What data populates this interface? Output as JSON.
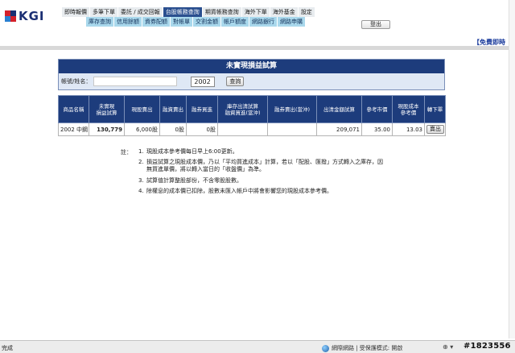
{
  "brand": {
    "name": "KGI",
    "colors": {
      "red": "#d4202a",
      "navy": "#1b2f73",
      "blue": "#2a7fd0"
    }
  },
  "menu_primary": [
    {
      "label": "即時報價",
      "active": false
    },
    {
      "label": "多筆下單",
      "active": false
    },
    {
      "label": "委託 / 成交回報",
      "active": false
    },
    {
      "label": "台股帳務查詢",
      "active": true
    },
    {
      "label": "期貨帳務查詢",
      "active": false
    },
    {
      "label": "海外下單",
      "active": false
    },
    {
      "label": "海外基金",
      "active": false
    },
    {
      "label": "設定",
      "active": false
    }
  ],
  "menu_secondary": [
    {
      "label": "庫存查詢"
    },
    {
      "label": "信用餘額"
    },
    {
      "label": "資券配額"
    },
    {
      "label": "對帳單"
    },
    {
      "label": "交割金額"
    },
    {
      "label": "帳戶額度"
    },
    {
      "label": "網路銀行"
    },
    {
      "label": "網路申購"
    }
  ],
  "logout_label": "登出",
  "right_link": "【免費即時",
  "calc_panel": {
    "title": "未實現損益試算",
    "account_label": "帳號/姓名：",
    "stock_code": "2002",
    "query_label": "查詢"
  },
  "table": {
    "headers": [
      "商品名稱",
      "未實現\n損益試算",
      "現股賣出",
      "融資賣出",
      "融券買進",
      "庫存出清試算\n融資買進(當沖)",
      "融券賣出(當沖)",
      "出清金額試算",
      "參考市價",
      "現股成本\n參考價",
      "轉下單"
    ],
    "rows": [
      {
        "name": "2002 中鋼",
        "unrealized": "130,779",
        "cash_sell": "6,000股",
        "margin_sell": "0股",
        "short_buy": "0股",
        "margin_buy_day": "",
        "short_sell_day": "",
        "clear_amount": "209,071",
        "market_price": "35.00",
        "cost_price": "13.03",
        "action": "賣出"
      }
    ]
  },
  "notes": {
    "head": "註：",
    "items": [
      {
        "num": "1.",
        "text": "現股成本參考價每日早上6:00更新。"
      },
      {
        "num": "2.",
        "text": "損益試算之現股成本價，乃以「平均買進成本」計算，若以「配股、匯撥」方式轉入之庫存，因無買進單價，將以轉入當日的「收盤價」為準。"
      },
      {
        "num": "3.",
        "text": "試算值計算整股部份，不含零股股數。"
      },
      {
        "num": "4.",
        "text": "除權息的成本價已扣除，股數未匯入帳戶中將會影響您的現股成本參考價。"
      }
    ]
  },
  "status": {
    "left": "完成",
    "zone": "網際網路 | 受保護模式: 開啟",
    "zoom": "⊕ ▾",
    "watermark": "#1823556"
  }
}
